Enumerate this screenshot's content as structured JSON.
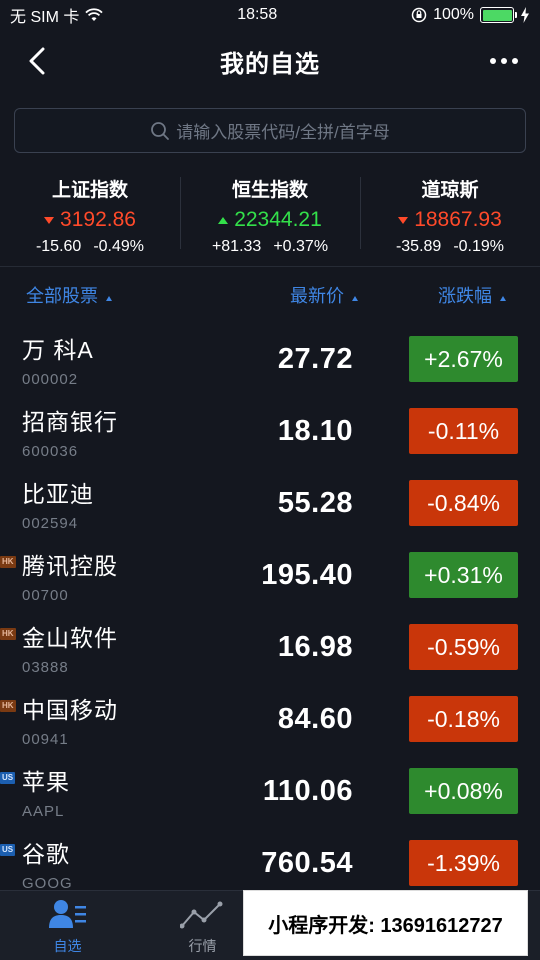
{
  "status_bar": {
    "carrier": "无 SIM 卡",
    "time": "18:58",
    "battery": "100%",
    "battery_level": 1.0
  },
  "nav": {
    "title": "我的自选"
  },
  "search": {
    "placeholder": "请输入股票代码/全拼/首字母"
  },
  "indices": [
    {
      "name": "上证指数",
      "value": "3192.86",
      "change": "-15.60",
      "percent": "-0.49%",
      "direction": "down"
    },
    {
      "name": "恒生指数",
      "value": "22344.21",
      "change": "+81.33",
      "percent": "+0.37%",
      "direction": "up"
    },
    {
      "name": "道琼斯",
      "value": "18867.93",
      "change": "-35.89",
      "percent": "-0.19%",
      "direction": "down"
    }
  ],
  "list_header": {
    "name": "全部股票",
    "price": "最新价",
    "change": "涨跌幅"
  },
  "stocks": [
    {
      "name": "万 科A",
      "code": "000002",
      "price": "27.72",
      "change": "+2.67%",
      "direction": "up",
      "market": ""
    },
    {
      "name": "招商银行",
      "code": "600036",
      "price": "18.10",
      "change": "-0.11%",
      "direction": "down",
      "market": ""
    },
    {
      "name": "比亚迪",
      "code": "002594",
      "price": "55.28",
      "change": "-0.84%",
      "direction": "down",
      "market": ""
    },
    {
      "name": "腾讯控股",
      "code": "00700",
      "price": "195.40",
      "change": "+0.31%",
      "direction": "up",
      "market": "HK"
    },
    {
      "name": "金山软件",
      "code": "03888",
      "price": "16.98",
      "change": "-0.59%",
      "direction": "down",
      "market": "HK"
    },
    {
      "name": "中国移动",
      "code": "00941",
      "price": "84.60",
      "change": "-0.18%",
      "direction": "down",
      "market": "HK"
    },
    {
      "name": "苹果",
      "code": "AAPL",
      "price": "110.06",
      "change": "+0.08%",
      "direction": "up",
      "market": "US"
    },
    {
      "name": "谷歌",
      "code": "GOOG",
      "price": "760.54",
      "change": "-1.39%",
      "direction": "down",
      "market": "US"
    }
  ],
  "tabs": [
    {
      "label": "自选",
      "icon": "user-list-icon",
      "active": true
    },
    {
      "label": "行情",
      "icon": "trend-line-icon",
      "active": false
    }
  ],
  "promo": {
    "text": "小程序开发: 13691612727"
  },
  "colors": {
    "background": "#14171f",
    "accent": "#3f86e4",
    "up": "#33e04a",
    "down": "#ff4a2a",
    "up_badge": "#2e8a2e",
    "down_badge": "#c9360a"
  }
}
